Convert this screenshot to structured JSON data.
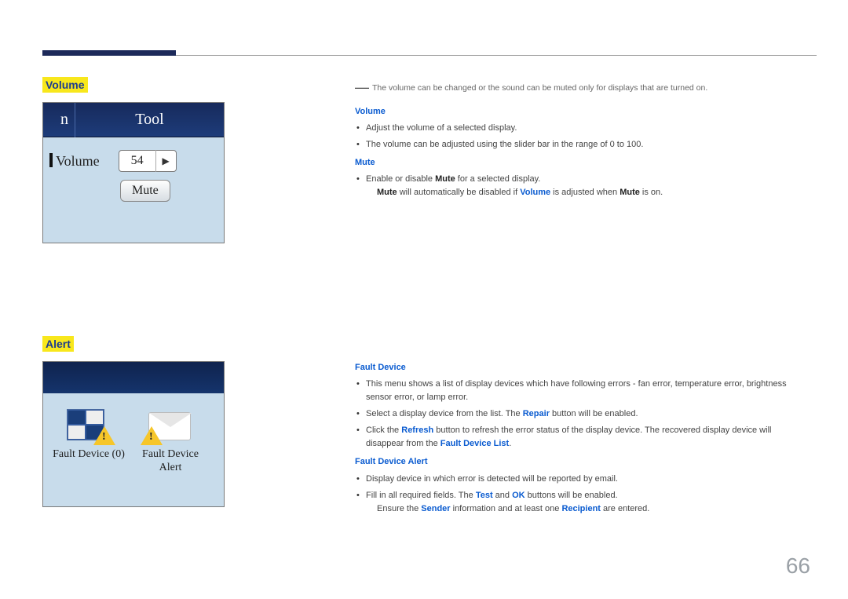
{
  "page_number": "66",
  "left": {
    "volume_title": "Volume",
    "alert_title": "Alert",
    "vol_tab_n": "n",
    "vol_tab_tool": "Tool",
    "vol_label": "Volume",
    "vol_value": "54",
    "mute_button": "Mute",
    "fault_device_label": "Fault Device (0)",
    "fault_alert_label": "Fault Device Alert"
  },
  "right": {
    "note": "The volume can be changed or the sound can be muted only for displays that are turned on.",
    "volume_h": "Volume",
    "volume_b1": "Adjust the volume of a selected display.",
    "volume_b2": "The volume can be adjusted using the slider bar in the range of 0 to 100.",
    "mute_h": "Mute",
    "mute_b1_pre": "Enable or disable ",
    "mute_b1_bold": "Mute",
    "mute_b1_post": " for a selected display.",
    "mute_b2_a": "Mute",
    "mute_b2_b": " will automatically be disabled if ",
    "mute_b2_c": "Volume",
    "mute_b2_d": " is adjusted when ",
    "mute_b2_e": "Mute",
    "mute_b2_f": " is on.",
    "fd_h": "Fault Device",
    "fd_b1": "This menu shows a list of display devices which have following errors - fan error, temperature error, brightness sensor error, or lamp error.",
    "fd_b2_pre": "Select a display device from the list. The ",
    "fd_b2_bold": "Repair",
    "fd_b2_post": " button will be enabled.",
    "fd_b3_pre": "Click the ",
    "fd_b3_bold": "Refresh",
    "fd_b3_mid": " button to refresh the error status of the display device. The recovered display device will disappear from the ",
    "fd_b3_bold2": "Fault Device List",
    "fd_b3_post": ".",
    "fda_h": "Fault Device Alert",
    "fda_b1": "Display device in which error is detected will be reported by email.",
    "fda_b2_pre": "Fill in all required fields. The ",
    "fda_b2_bold1": "Test",
    "fda_b2_mid": " and ",
    "fda_b2_bold2": "OK",
    "fda_b2_post": " buttons will be enabled.",
    "fda_b3_pre": "Ensure the ",
    "fda_b3_bold1": "Sender",
    "fda_b3_mid": " information and at least one ",
    "fda_b3_bold2": "Recipient",
    "fda_b3_post": " are entered."
  }
}
